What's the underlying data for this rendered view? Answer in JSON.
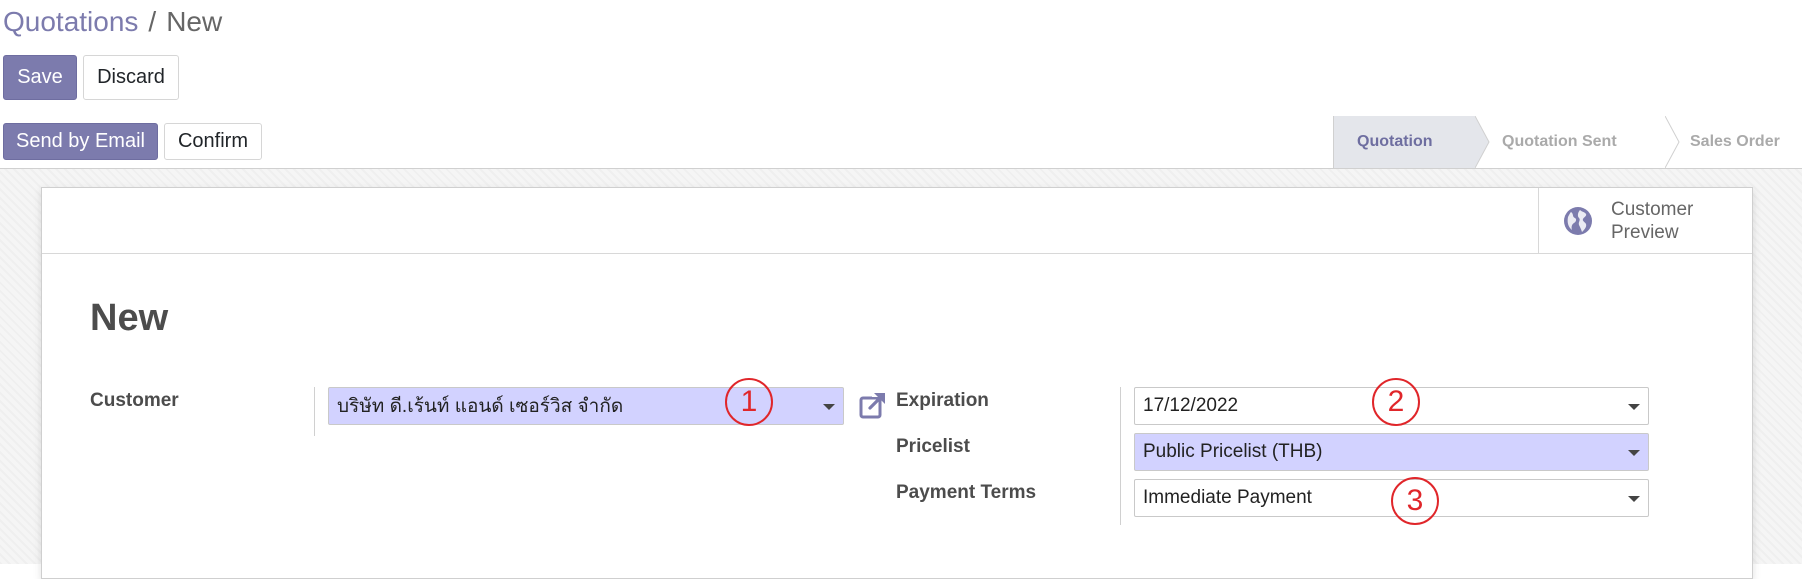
{
  "breadcrumb": {
    "parent": "Quotations",
    "separator": "/",
    "current": "New"
  },
  "control_buttons": {
    "save": "Save",
    "discard": "Discard"
  },
  "status_buttons": {
    "send_email": "Send by Email",
    "confirm": "Confirm"
  },
  "stages": [
    {
      "label": "Quotation",
      "current": true
    },
    {
      "label": "Quotation Sent",
      "current": false
    },
    {
      "label": "Sales Order",
      "current": false
    }
  ],
  "smart_button": {
    "label": "Customer Preview",
    "icon": "globe-icon"
  },
  "record": {
    "title": "New"
  },
  "fields": {
    "customer": {
      "label": "Customer",
      "value": "บริษัท  ดี.เร้นท์ แอนด์ เซอร์วิส  จำกัด"
    },
    "expiration": {
      "label": "Expiration",
      "value": "17/12/2022"
    },
    "pricelist": {
      "label": "Pricelist",
      "value": "Public Pricelist (THB)"
    },
    "payment_terms": {
      "label": "Payment Terms",
      "value": "Immediate Payment"
    }
  },
  "annotations": [
    "1",
    "2",
    "3"
  ],
  "colors": {
    "primary": "#7c7bad",
    "required_bg": "#d2d2ff",
    "annotation": "#e0262a",
    "current_stage_bg": "#e4e6eb"
  }
}
